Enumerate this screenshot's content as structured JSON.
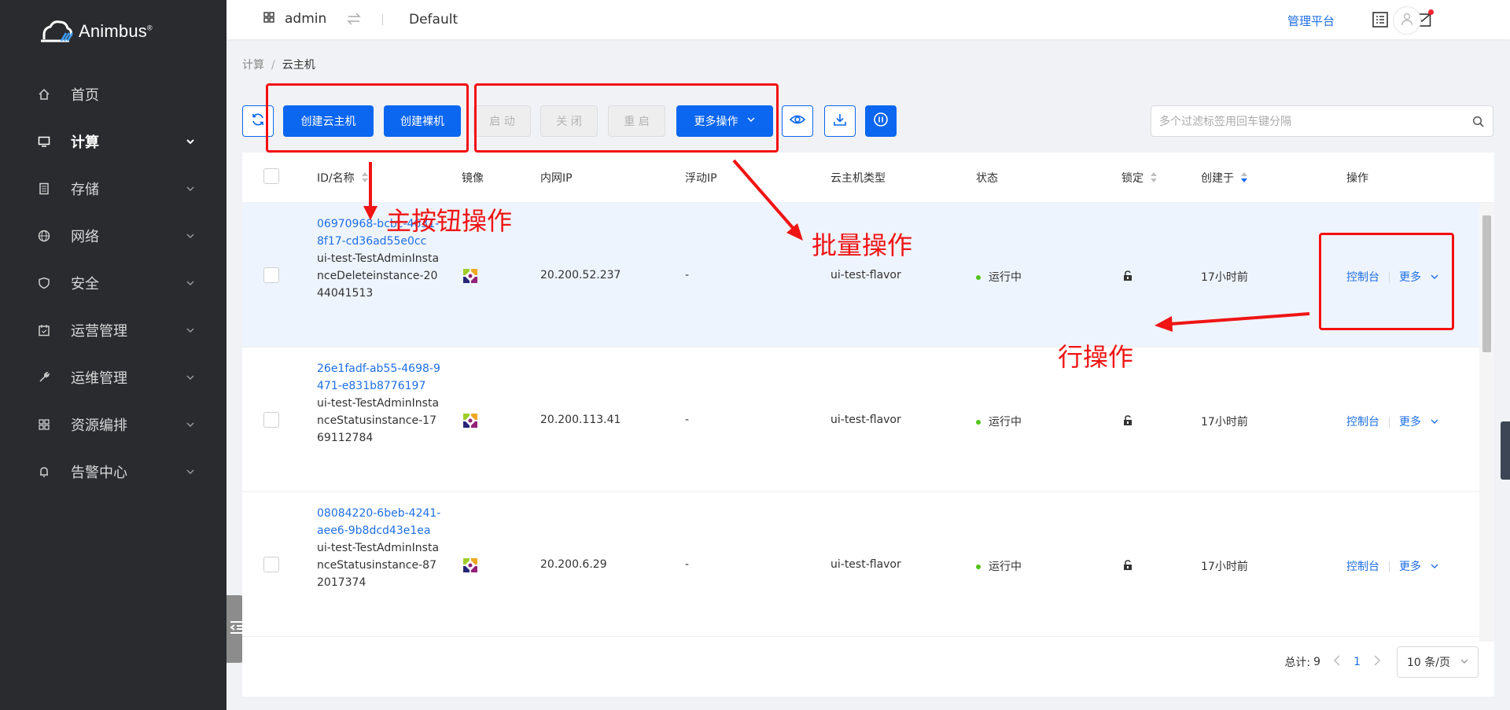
{
  "brand": {
    "name": "Animbus",
    "mark": "®"
  },
  "sidebar": {
    "items": [
      {
        "label": "首页",
        "icon": "home-icon",
        "active": false,
        "expandable": false
      },
      {
        "label": "计算",
        "icon": "monitor-icon",
        "active": true,
        "expandable": true
      },
      {
        "label": "存储",
        "icon": "storage-icon",
        "active": false,
        "expandable": true
      },
      {
        "label": "网络",
        "icon": "globe-icon",
        "active": false,
        "expandable": true
      },
      {
        "label": "安全",
        "icon": "shield-icon",
        "active": false,
        "expandable": true
      },
      {
        "label": "运营管理",
        "icon": "calendar-icon",
        "active": false,
        "expandable": true
      },
      {
        "label": "运维管理",
        "icon": "wrench-icon",
        "active": false,
        "expandable": true
      },
      {
        "label": "资源编排",
        "icon": "grid-icon",
        "active": false,
        "expandable": true
      },
      {
        "label": "告警中心",
        "icon": "bell-icon",
        "active": false,
        "expandable": true
      }
    ]
  },
  "header": {
    "project": "admin",
    "domain": "Default",
    "admin_platform": "管理平台"
  },
  "breadcrumb": {
    "parent": "计算",
    "separator": "/",
    "current": "云主机"
  },
  "toolbar": {
    "create_vm": "创建云主机",
    "create_baremetal": "创建裸机",
    "start": "启 动",
    "stop": "关 闭",
    "reboot": "重 启",
    "more_actions": "更多操作",
    "search_placeholder": "多个过滤标签用回车键分隔"
  },
  "table": {
    "columns": {
      "id_name": "ID/名称",
      "image": "镜像",
      "fixed_ip": "内网IP",
      "floating_ip": "浮动IP",
      "flavor": "云主机类型",
      "status": "状态",
      "locked": "锁定",
      "created": "创建于",
      "actions": "操作"
    },
    "rows": [
      {
        "id": "06970968-bcbc-4631-8f17-cd36ad55e0cc",
        "name": "ui-test-TestAdminInstanceDeleteinstance-2044041513",
        "fixed_ip": "20.200.52.237",
        "floating_ip": "-",
        "flavor": "ui-test-flavor",
        "status": "运行中",
        "created": "17小时前",
        "console": "控制台",
        "more": "更多"
      },
      {
        "id": "26e1fadf-ab55-4698-9471-e831b8776197",
        "name": "ui-test-TestAdminInstanceStatusinstance-1769112784",
        "fixed_ip": "20.200.113.41",
        "floating_ip": "-",
        "flavor": "ui-test-flavor",
        "status": "运行中",
        "created": "17小时前",
        "console": "控制台",
        "more": "更多"
      },
      {
        "id": "08084220-6beb-4241-aee6-9b8dcd43e1ea",
        "name": "ui-test-TestAdminInstanceStatusinstance-872017374",
        "fixed_ip": "20.200.6.29",
        "floating_ip": "-",
        "flavor": "ui-test-flavor",
        "status": "运行中",
        "created": "17小时前",
        "console": "控制台",
        "more": "更多"
      }
    ]
  },
  "pagination": {
    "total_label": "总计:",
    "total": "9",
    "page": "1",
    "page_size": "10 条/页"
  },
  "annotations": {
    "main_buttons": "主按钮操作",
    "batch": "批量操作",
    "row_action": "行操作"
  },
  "colors": {
    "primary": "#0b66f0",
    "sidebar": "#2a2b2f",
    "annotation": "#f01414",
    "running": "#52c41a"
  }
}
